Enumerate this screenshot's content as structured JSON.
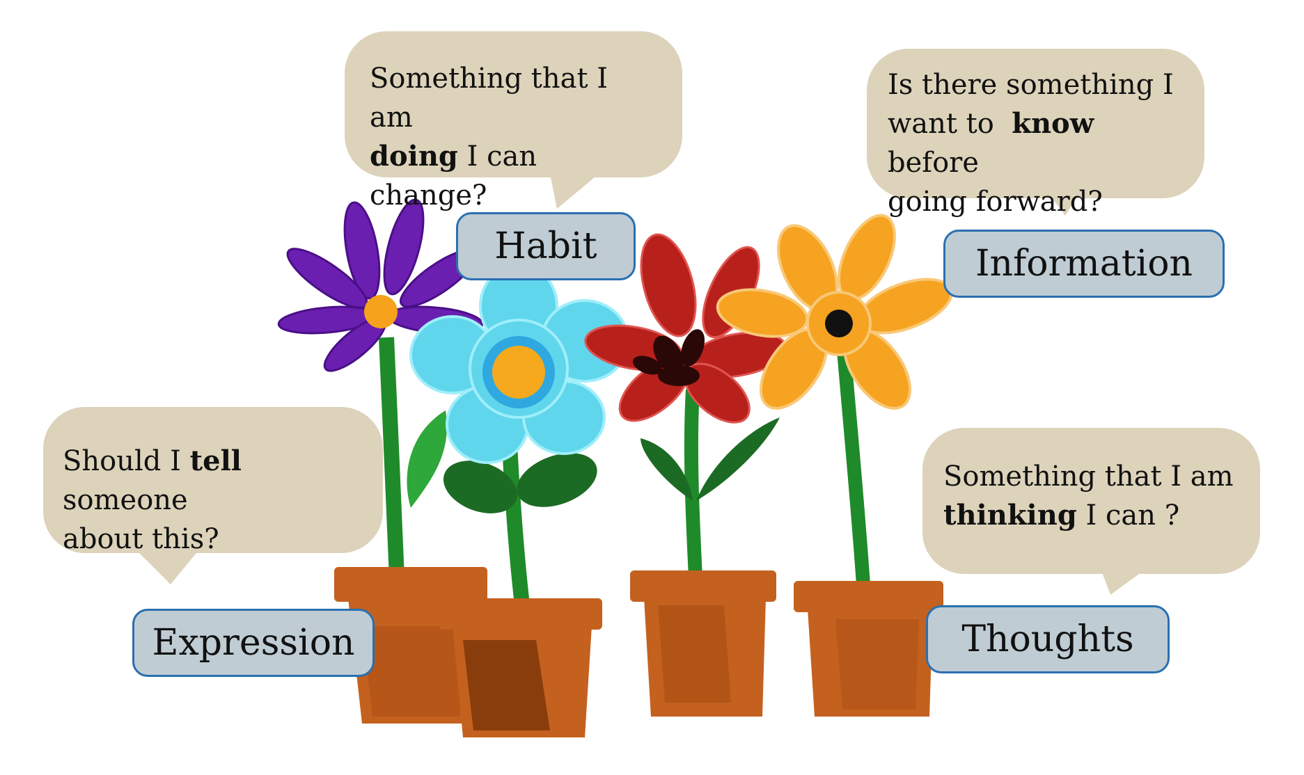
{
  "bubbles": {
    "habit": {
      "before": "Something that I am",
      "bold": "doing",
      "after": " I can change?"
    },
    "information": {
      "line1": "Is there something I",
      "before": "want to  ",
      "bold": "know",
      "after": " before",
      "line3": "going forward?"
    },
    "expression": {
      "before": "Should I ",
      "bold": "tell",
      "after": " someone",
      "line2": "about this?"
    },
    "thoughts": {
      "line1": "Something that I am",
      "bold": "thinking",
      "after": " I can ?"
    }
  },
  "labels": {
    "habit": "Habit",
    "information": "Information",
    "expression": "Expression",
    "thoughts": "Thoughts"
  },
  "colors": {
    "bubble": "#dcd3ba",
    "label_fill": "#bfccd4",
    "label_border": "#2a6fb0",
    "purple_flower": "#6a1fb0",
    "blue_flower": "#5fd6ec",
    "red_flower": "#b8201c",
    "orange_flower": "#f5a321",
    "pot": "#c4611f",
    "stem": "#1f8a2a"
  }
}
